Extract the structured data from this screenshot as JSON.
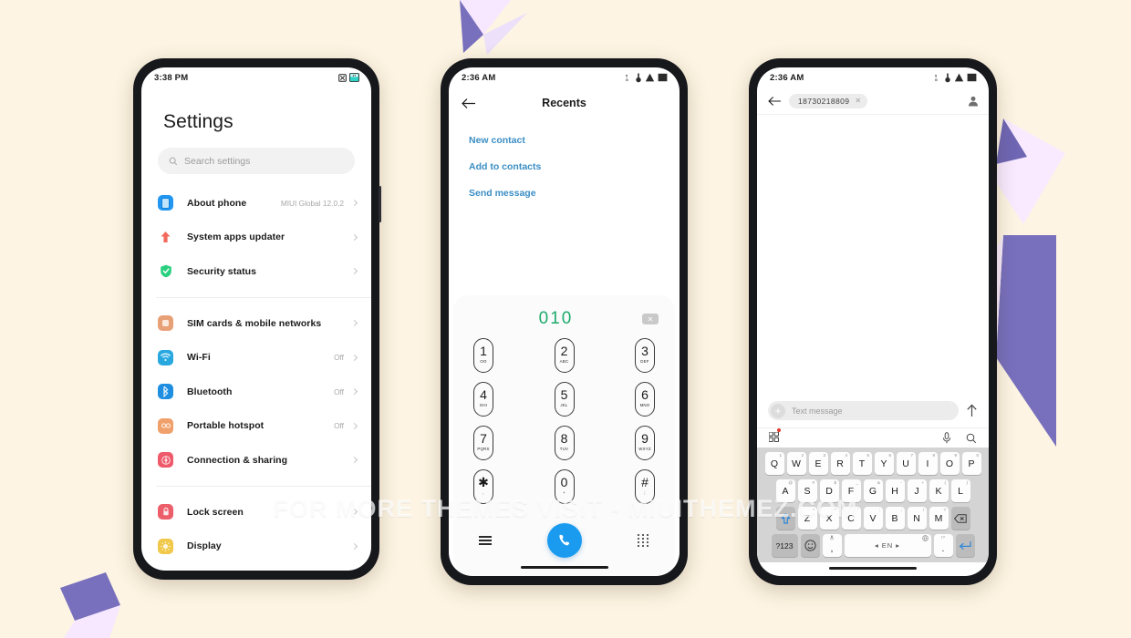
{
  "theme": {
    "background": "#fdf4e3",
    "deco_purple": "#7870bd",
    "deco_lilac": "#f7e8ff",
    "accent_blue": "#1b9bf0",
    "link_blue": "#3b8ec4",
    "dial_green": "#1eaa6c",
    "frame": "#17181c"
  },
  "watermark": "FOR MORE THEMES VISIT - MIUITHEMEZ.COM",
  "phone_settings": {
    "statusbar": {
      "time": "3:38 PM",
      "icons": [
        "no-sim-icon",
        "screenshot-icon"
      ]
    },
    "page_title": "Settings",
    "search": {
      "placeholder": "Search settings",
      "icon": "search-icon"
    },
    "groups": [
      {
        "items": [
          {
            "label": "About phone",
            "value": "MIUI Global 12.0.2",
            "icon": "about-phone-icon",
            "icon_color": "#2196f3",
            "name": "sidebar-item-about-phone"
          },
          {
            "label": "System apps updater",
            "value": "",
            "icon": "system-apps-updater-icon",
            "icon_color": "#f2695c",
            "name": "sidebar-item-system-apps-updater"
          },
          {
            "label": "Security status",
            "value": "",
            "icon": "security-status-icon",
            "icon_color": "#2ad07f",
            "name": "sidebar-item-security-status"
          }
        ]
      },
      {
        "items": [
          {
            "label": "SIM cards & mobile networks",
            "value": "",
            "icon": "sim-card-icon",
            "icon_color": "#e8a077",
            "name": "sidebar-item-sim-cards"
          },
          {
            "label": "Wi-Fi",
            "value": "Off",
            "icon": "wifi-icon",
            "icon_color": "#29a8e0",
            "name": "sidebar-item-wifi"
          },
          {
            "label": "Bluetooth",
            "value": "Off",
            "icon": "bluetooth-icon",
            "icon_color": "#1e8fe0",
            "name": "sidebar-item-bluetooth"
          },
          {
            "label": "Portable hotspot",
            "value": "Off",
            "icon": "hotspot-icon",
            "icon_color": "#f0a06a",
            "name": "sidebar-item-portable-hotspot"
          },
          {
            "label": "Connection & sharing",
            "value": "",
            "icon": "connection-sharing-icon",
            "icon_color": "#ee5a6a",
            "name": "sidebar-item-connection-sharing"
          }
        ]
      },
      {
        "items": [
          {
            "label": "Lock screen",
            "value": "",
            "icon": "lock-icon",
            "icon_color": "#ec5f6a",
            "name": "sidebar-item-lock-screen"
          },
          {
            "label": "Display",
            "value": "",
            "icon": "display-icon",
            "icon_color": "#f0c84a",
            "name": "sidebar-item-display"
          }
        ]
      }
    ]
  },
  "phone_dialer": {
    "statusbar": {
      "time": "2:36 AM",
      "icons": [
        "signal-5g-icon",
        "vibrate-icon",
        "signal-icon",
        "battery-icon"
      ]
    },
    "header": {
      "back_icon": "back-arrow-icon",
      "title": "Recents"
    },
    "actions": [
      {
        "label": "New contact",
        "name": "new-contact-action"
      },
      {
        "label": "Add to contacts",
        "name": "add-to-contacts-action"
      },
      {
        "label": "Send message",
        "name": "send-message-action"
      }
    ],
    "dialed_number": "010",
    "backspace_icon": "backspace-icon",
    "keys": [
      [
        {
          "digit": "1",
          "sub": "OO"
        },
        {
          "digit": "2",
          "sub": "ABC"
        },
        {
          "digit": "3",
          "sub": "DEF"
        }
      ],
      [
        {
          "digit": "4",
          "sub": "GHI"
        },
        {
          "digit": "5",
          "sub": "JKL"
        },
        {
          "digit": "6",
          "sub": "MNO"
        }
      ],
      [
        {
          "digit": "7",
          "sub": "PQRS"
        },
        {
          "digit": "8",
          "sub": "TUV"
        },
        {
          "digit": "9",
          "sub": "WXYZ"
        }
      ],
      [
        {
          "digit": "✱",
          "sub": ","
        },
        {
          "digit": "0",
          "sub": "+"
        },
        {
          "digit": "#",
          "sub": ";"
        }
      ]
    ],
    "bottom_bar": {
      "menu_icon": "hamburger-menu-icon",
      "call_icon": "call-icon",
      "keypad_icon": "keypad-grid-icon"
    }
  },
  "phone_messaging": {
    "statusbar": {
      "time": "2:36 AM",
      "icons": [
        "signal-5g-icon",
        "vibrate-icon",
        "signal-icon",
        "battery-icon"
      ]
    },
    "header": {
      "back_icon": "back-arrow-icon",
      "recipient": "18730218809",
      "remove_icon": "close-icon",
      "contact_icon": "contact-person-icon"
    },
    "compose": {
      "add_icon": "plus-icon",
      "placeholder": "Text message",
      "send_icon": "send-arrow-icon"
    },
    "kb_toolbar": {
      "apps_icon": "keyboard-apps-icon",
      "mic_icon": "microphone-icon",
      "search_icon": "search-icon"
    },
    "keyboard": {
      "row1": [
        {
          "key": "Q",
          "sup": "1"
        },
        {
          "key": "W",
          "sup": "2"
        },
        {
          "key": "E",
          "sup": "3"
        },
        {
          "key": "R",
          "sup": "4"
        },
        {
          "key": "T",
          "sup": "5"
        },
        {
          "key": "Y",
          "sup": "6"
        },
        {
          "key": "U",
          "sup": "7"
        },
        {
          "key": "I",
          "sup": "8"
        },
        {
          "key": "O",
          "sup": "9"
        },
        {
          "key": "P",
          "sup": "0"
        }
      ],
      "row2": [
        {
          "key": "A",
          "sup": "@"
        },
        {
          "key": "S",
          "sup": "#"
        },
        {
          "key": "D",
          "sup": "$"
        },
        {
          "key": "F",
          "sup": "_"
        },
        {
          "key": "G",
          "sup": "&"
        },
        {
          "key": "H",
          "sup": "-"
        },
        {
          "key": "J",
          "sup": "+"
        },
        {
          "key": "K",
          "sup": "("
        },
        {
          "key": "L",
          "sup": ")"
        }
      ],
      "row3": [
        {
          "key": "Z",
          "sup": "*"
        },
        {
          "key": "X",
          "sup": "\""
        },
        {
          "key": "C",
          "sup": "'"
        },
        {
          "key": "V",
          "sup": ":"
        },
        {
          "key": "B",
          "sup": ";"
        },
        {
          "key": "N",
          "sup": "!"
        },
        {
          "key": "M",
          "sup": "?"
        }
      ],
      "shift_icon": "shift-up-arrow-icon",
      "backspace_icon": "backspace-delete-icon",
      "symbols_label": "?123",
      "emoji_icon": "emoji-smile-icon",
      "comma_label": ",",
      "comma_sup_icon": "microphone-small-icon",
      "space_label": "◂ EN ▸",
      "space_sup_icon": "globe-icon",
      "period_label": ".",
      "period_sup": "!?",
      "enter_icon": "enter-return-icon"
    }
  }
}
